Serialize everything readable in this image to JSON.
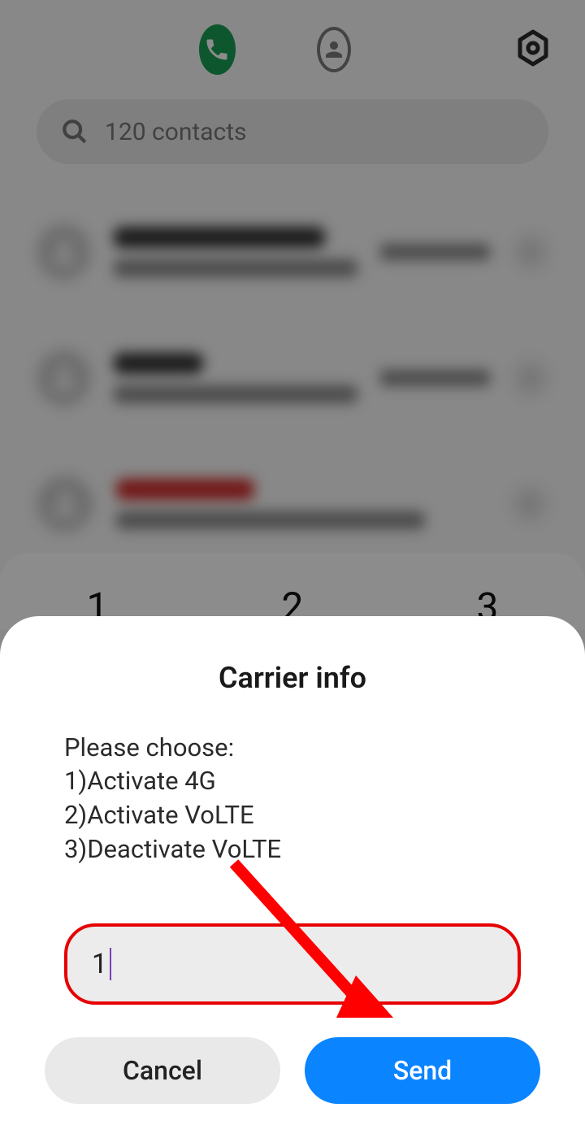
{
  "search": {
    "placeholder": "120 contacts"
  },
  "keypad": {
    "k1": "1",
    "k2": "2",
    "k3": "3"
  },
  "dialog": {
    "title": "Carrier info",
    "body": "Please choose:\n1)Activate 4G\n2)Activate VoLTE\n3)Deactivate VoLTE",
    "input_value": "1",
    "cancel_label": "Cancel",
    "send_label": "Send"
  },
  "colors": {
    "accent_green": "#1b9e55",
    "send_blue": "#0a84ff",
    "highlight_red": "#e60000"
  }
}
